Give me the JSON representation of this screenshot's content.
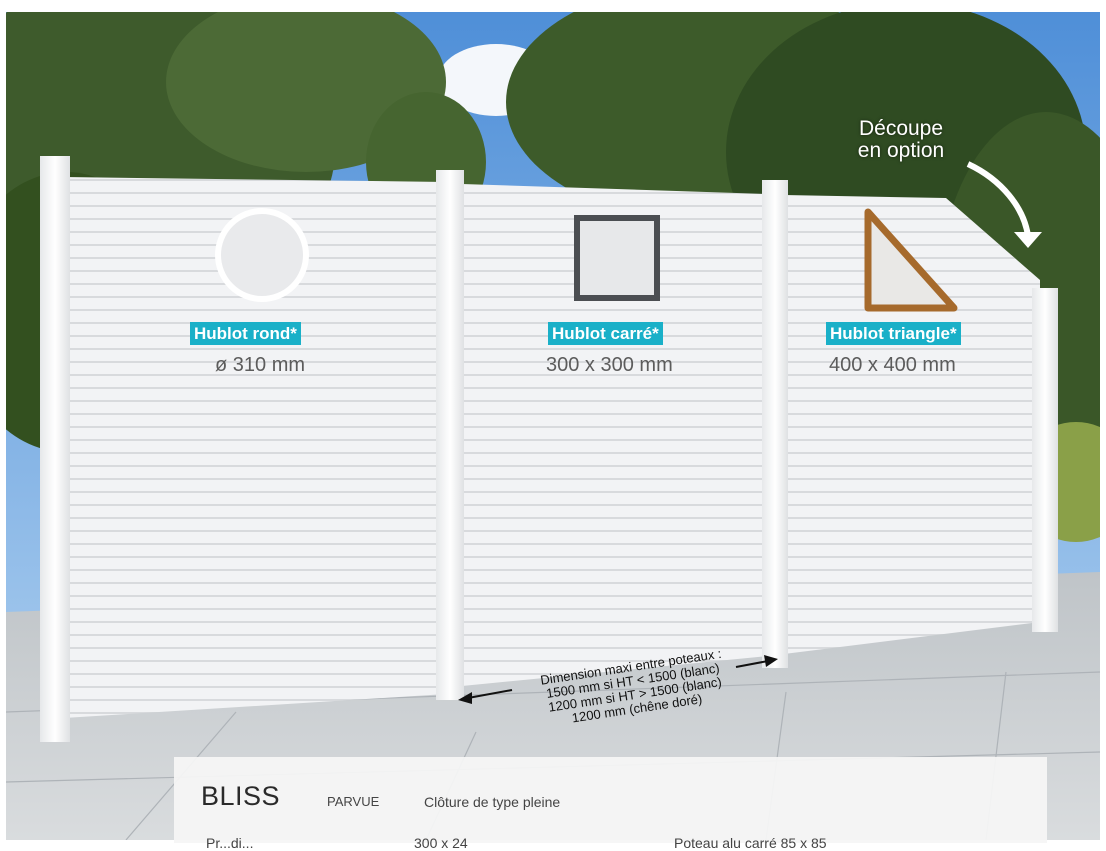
{
  "labels": {
    "round": {
      "name": "Hublot rond*",
      "size": "ø 310 mm"
    },
    "square": {
      "name": "Hublot carré*",
      "size": "300 x 300 mm"
    },
    "triangle": {
      "name": "Hublot triangle*",
      "size": "400 x 400 mm"
    }
  },
  "decoupe": {
    "line1": "Découpe",
    "line2": "en option"
  },
  "dimension": {
    "line1": "Dimension maxi entre poteaux :",
    "line2": "1500 mm si HT < 1500 (blanc)",
    "line3": "1200 mm si HT > 1500 (blanc)",
    "line4": "1200 mm (chêne doré)"
  },
  "product": {
    "name": "BLISS",
    "brand": "PARVUE",
    "type": "Clôture de type pleine",
    "spec_left_label": "Pr...di...",
    "spec_left_value": "300 x 24",
    "spec_right": "Poteau alu carré 85 x 85"
  },
  "colors": {
    "badge": "#1ab0c8",
    "panel": "#f0f0f0",
    "fence": "#ffffff"
  }
}
